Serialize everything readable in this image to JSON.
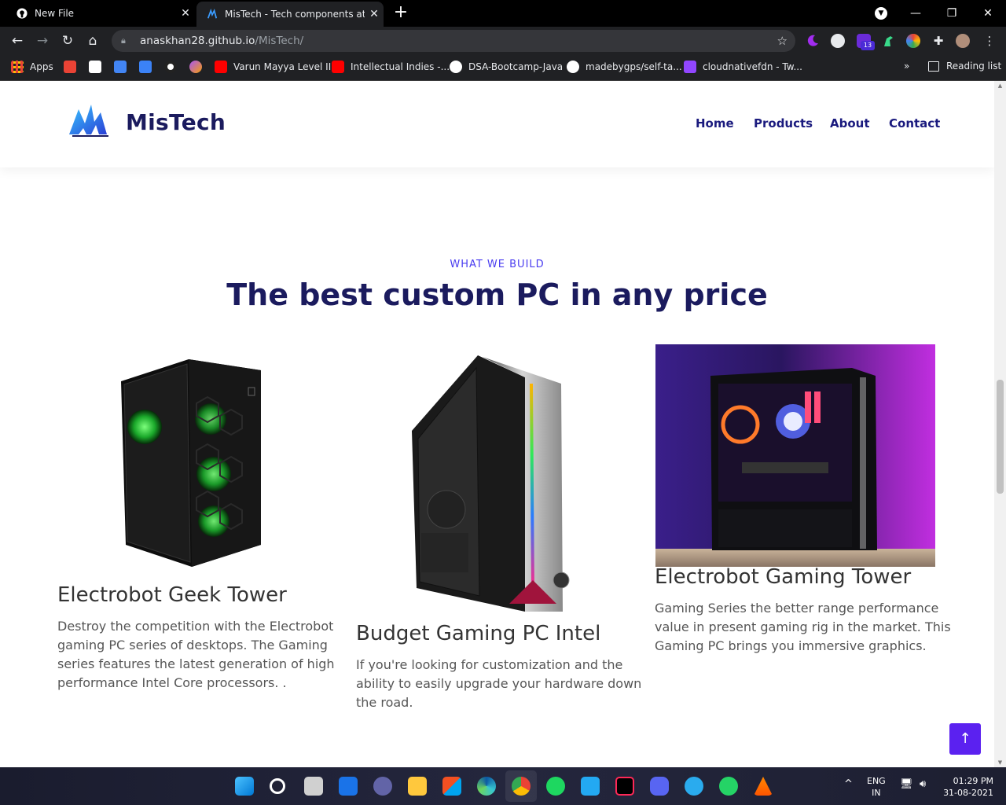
{
  "browser": {
    "tabs": [
      {
        "title": "New File",
        "icon": "github-icon",
        "state": "inactive"
      },
      {
        "title": "MisTech - Tech components at it",
        "icon": "mistech-favicon-icon",
        "state": "active"
      }
    ],
    "new_tab": "+",
    "address": {
      "host": "anaskhan28.github.io",
      "path": "/MisTech/"
    },
    "bookmarks": [
      {
        "label": "Apps",
        "icon": "apps-grid-icon",
        "color": "#e8eaed"
      },
      {
        "label": "",
        "icon": "gmail-icon",
        "color": "#ea4335"
      },
      {
        "label": "",
        "icon": "vtu-icon",
        "color": "#ffffff"
      },
      {
        "label": "",
        "icon": "translate-icon",
        "color": "#4285f4"
      },
      {
        "label": "",
        "icon": "arrow-extension-icon",
        "color": "#3b82f6"
      },
      {
        "label": "",
        "icon": "circle-icon",
        "color": "#ffffff"
      },
      {
        "label": "",
        "icon": "colorful-icon",
        "color": "#a855f7"
      },
      {
        "label": "Varun Mayya Level II",
        "icon": "youtube-icon",
        "color": "#ff0000"
      },
      {
        "label": "Intellectual Indies -...",
        "icon": "youtube-icon",
        "color": "#ff0000"
      },
      {
        "label": "DSA-Bootcamp-Java",
        "icon": "github-icon",
        "color": "#ffffff"
      },
      {
        "label": "madebygps/self-ta...",
        "icon": "github-icon",
        "color": "#ffffff"
      },
      {
        "label": "cloudnativefdn - Tw...",
        "icon": "twitch-icon",
        "color": "#9146ff"
      }
    ],
    "more": "»",
    "reading_list": "Reading list",
    "extension_badge": "13"
  },
  "site": {
    "brand": "MisTech",
    "nav": [
      "Home",
      "Products",
      "About",
      "Contact"
    ],
    "eyebrow": "WHAT WE BUILD",
    "headline": "The best custom PC in any price",
    "cards": [
      {
        "title": "Electrobot Geek Tower",
        "text_lines": [
          "Destroy the competition with the Electrobot",
          "gaming PC series of desktops. The Gaming",
          "series features the latest generation of high",
          "performance Intel Core processors. ."
        ]
      },
      {
        "title": "Budget Gaming PC Intel",
        "text_lines": [
          "If you're looking for customization and the",
          "ability to easily upgrade your hardware down",
          "the road."
        ]
      },
      {
        "title": "Electrobot Gaming Tower",
        "text_lines": [
          "Gaming Series the better range performance",
          "value in present gaming rig in the market. This",
          "Gaming PC brings you immersive graphics."
        ]
      }
    ],
    "to_top": "↑"
  },
  "taskbar": {
    "lang": "ENG",
    "region": "IN",
    "time": "01:29 PM",
    "date": "31-08-2021"
  },
  "colors": {
    "brand_navy": "#1b1b5e",
    "accent_purple": "#5b21f0",
    "eyebrow": "#4a3df0"
  }
}
